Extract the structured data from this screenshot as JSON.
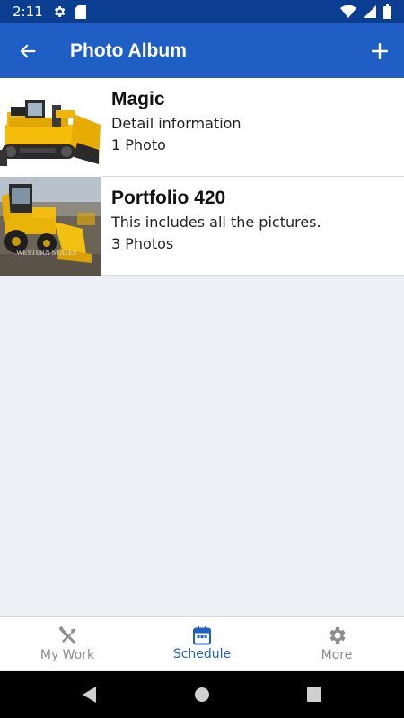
{
  "status_bar": {
    "time": "2:11",
    "icons": [
      "gear-icon",
      "sd-card-icon",
      "wifi-icon",
      "signal-icon",
      "battery-icon"
    ]
  },
  "app_bar": {
    "title": "Photo Album",
    "back_icon": "arrow-left-icon",
    "add_icon": "plus-icon"
  },
  "albums": [
    {
      "title": "Magic",
      "description": "Detail information",
      "count": "1 Photo",
      "thumbnail": "bulldozer"
    },
    {
      "title": "Portfolio 420",
      "description": "This includes all the pictures.",
      "count": "3 Photos",
      "thumbnail": "backhoe loader"
    }
  ],
  "thumbnail_watermark": "WESTERN STATES",
  "bottom_nav": {
    "items": [
      {
        "label": "My Work",
        "icon": "tools-icon",
        "active": false
      },
      {
        "label": "Schedule",
        "icon": "calendar-icon",
        "active": true
      },
      {
        "label": "More",
        "icon": "gear-icon",
        "active": false
      }
    ]
  },
  "colors": {
    "status_bar": "#0b3d91",
    "app_bar": "#1f5fc5",
    "background": "#eef0f5",
    "active_nav": "#1f5fc5",
    "inactive_nav": "#8d8d8d"
  }
}
